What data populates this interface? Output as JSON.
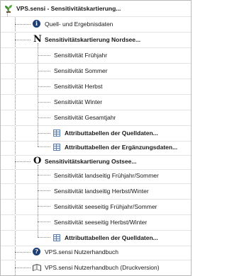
{
  "tree": {
    "root": {
      "label": "VPS.sensi - Sensitivitätskartierung...",
      "icon": "tree-plant-icon"
    },
    "quell": {
      "label": "Quell- und Ergebnisdaten",
      "icon": "info-icon",
      "icon_glyph": "i"
    },
    "nordsee": {
      "label": "Sensitivitätskartierung Nordsee...",
      "icon": "letter-n-icon",
      "icon_glyph": "N",
      "children": [
        "Sensitivität Frühjahr",
        "Sensitivität Sommer",
        "Sensitivität Herbst",
        "Sensitivität Winter",
        "Sensitivität Gesamtjahr",
        "Attributtabellen der Quelldaten...",
        "Attributtabellen der Ergänzungsdaten..."
      ]
    },
    "ostsee": {
      "label": "Sensitivitätskartierung Ostsee...",
      "icon": "letter-o-icon",
      "icon_glyph": "O",
      "children": [
        "Sensitivität landseitig Frühjahr/Sommer",
        "Sensitivität landseitig Herbst/Winter",
        "Sensitivität seeseitig Frühjahr/Sommer",
        "Sensitivität seeseitig Herbst/Winter",
        "Attributtabellen der Quelldaten..."
      ]
    },
    "help": {
      "label": "VPS.sensi Nutzerhandbuch",
      "icon": "help-icon",
      "icon_glyph": "?"
    },
    "book": {
      "label": "VPS.sensi Nutzerhandbuch (Druckversion)",
      "icon": "book-icon"
    }
  },
  "colors": {
    "icon_blue": "#1d3f73",
    "plant_green": "#3d8b2f",
    "row_divider": "#e3e3e3"
  }
}
